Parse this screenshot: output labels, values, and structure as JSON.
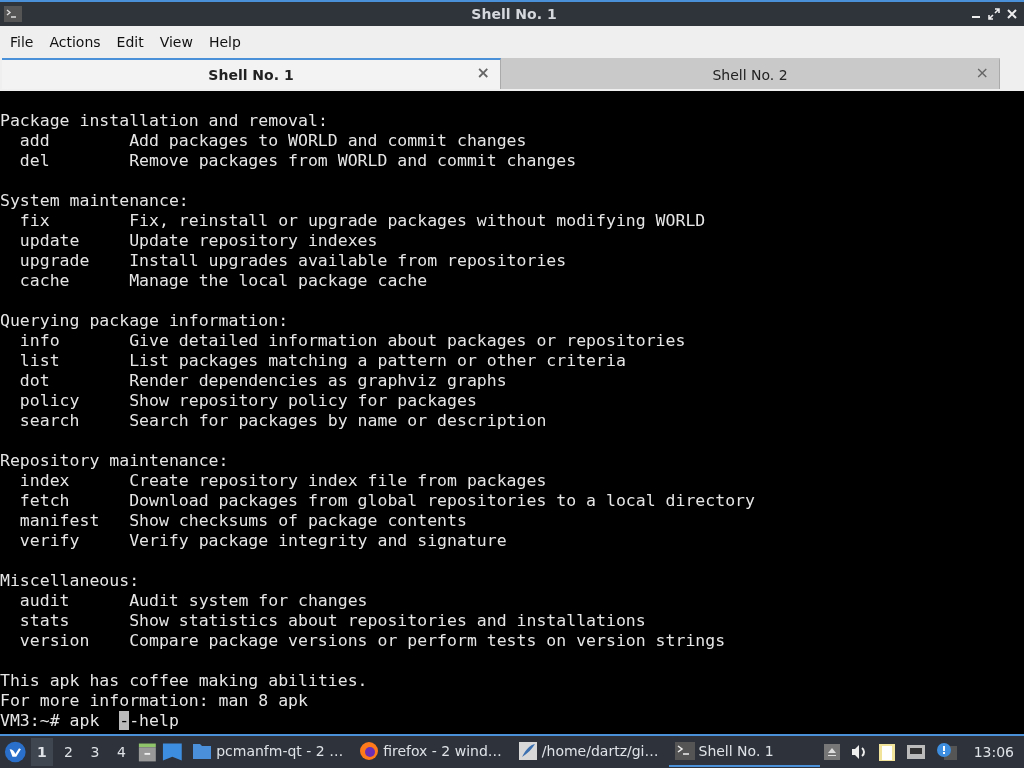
{
  "window": {
    "title": "Shell No. 1"
  },
  "menu": [
    "File",
    "Actions",
    "Edit",
    "View",
    "Help"
  ],
  "tabs": [
    {
      "label": "Shell No. 1",
      "selected": true,
      "close": "×"
    },
    {
      "label": "Shell No. 2",
      "selected": false,
      "close": "×"
    }
  ],
  "terminal": {
    "sections": [
      {
        "heading": "Package installation and removal:",
        "commands": [
          {
            "name": "add",
            "description": "Add packages to WORLD and commit changes"
          },
          {
            "name": "del",
            "description": "Remove packages from WORLD and commit changes"
          }
        ]
      },
      {
        "heading": "System maintenance:",
        "commands": [
          {
            "name": "fix",
            "description": "Fix, reinstall or upgrade packages without modifying WORLD"
          },
          {
            "name": "update",
            "description": "Update repository indexes"
          },
          {
            "name": "upgrade",
            "description": "Install upgrades available from repositories"
          },
          {
            "name": "cache",
            "description": "Manage the local package cache"
          }
        ]
      },
      {
        "heading": "Querying package information:",
        "commands": [
          {
            "name": "info",
            "description": "Give detailed information about packages or repositories"
          },
          {
            "name": "list",
            "description": "List packages matching a pattern or other criteria"
          },
          {
            "name": "dot",
            "description": "Render dependencies as graphviz graphs"
          },
          {
            "name": "policy",
            "description": "Show repository policy for packages"
          },
          {
            "name": "search",
            "description": "Search for packages by name or description"
          }
        ]
      },
      {
        "heading": "Repository maintenance:",
        "commands": [
          {
            "name": "index",
            "description": "Create repository index file from packages"
          },
          {
            "name": "fetch",
            "description": "Download packages from global repositories to a local directory"
          },
          {
            "name": "manifest",
            "description": "Show checksums of package contents"
          },
          {
            "name": "verify",
            "description": "Verify package integrity and signature"
          }
        ]
      },
      {
        "heading": "Miscellaneous:",
        "commands": [
          {
            "name": "audit",
            "description": "Audit system for changes"
          },
          {
            "name": "stats",
            "description": "Show statistics about repositories and installations"
          },
          {
            "name": "version",
            "description": "Compare package versions or perform tests on version strings"
          }
        ]
      }
    ],
    "footer": [
      "This apk has coffee making abilities.",
      "For more information: man 8 apk"
    ],
    "prompt": {
      "before": "VM3:~# apk  ",
      "cursor": "-",
      "after": "-help"
    }
  },
  "taskbar": {
    "desktops": [
      {
        "label": "1",
        "selected": true
      },
      {
        "label": "2",
        "selected": false
      },
      {
        "label": "3",
        "selected": false
      },
      {
        "label": "4",
        "selected": false
      }
    ],
    "tasks": [
      {
        "kind": "folder",
        "label": "pcmanfm-qt - 2 …",
        "selected": false
      },
      {
        "kind": "browser",
        "label": "firefox - 2 wind…",
        "selected": false
      },
      {
        "kind": "editor",
        "label": "/home/dartz/gi…",
        "selected": false
      },
      {
        "kind": "terminal",
        "label": "Shell No. 1",
        "selected": true
      }
    ],
    "clock": "13:06"
  }
}
